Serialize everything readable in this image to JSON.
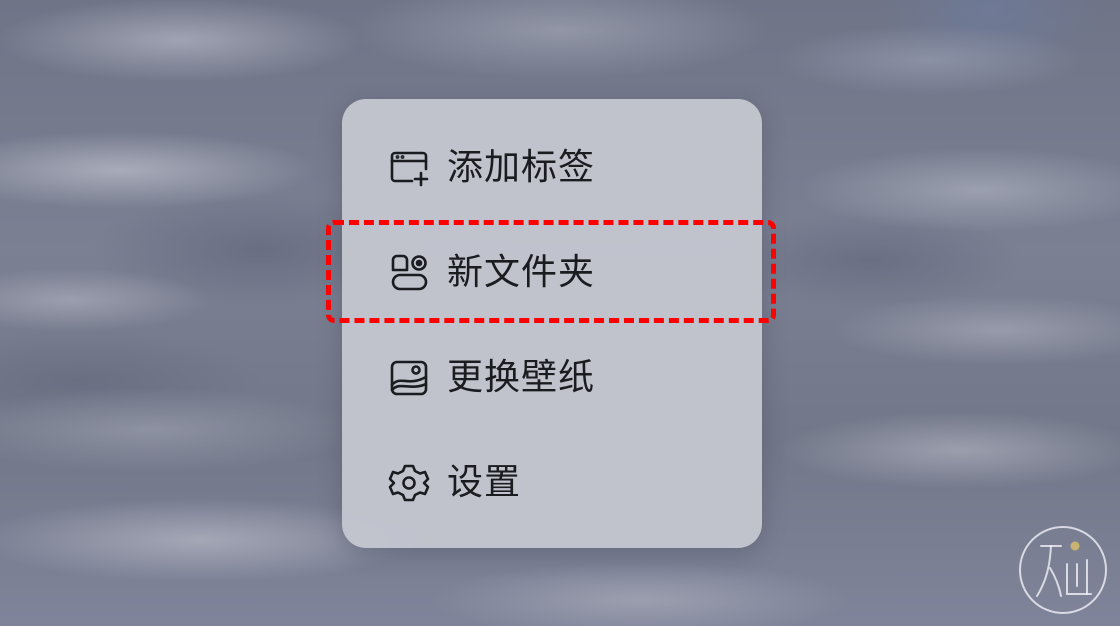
{
  "menu": {
    "items": [
      {
        "label": "添加标签",
        "icon": "tab-add-icon"
      },
      {
        "label": "新文件夹",
        "icon": "folder-icon"
      },
      {
        "label": "更换壁纸",
        "icon": "wallpaper-icon"
      },
      {
        "label": "设置",
        "icon": "gear-icon"
      }
    ]
  },
  "highlight": {
    "target": "新文件夹",
    "color": "#ff0000",
    "style": "dashed"
  },
  "colors": {
    "menu_background": "#c4c6d0",
    "menu_text": "#1b1c20",
    "wallpaper": "#777c8e"
  },
  "watermark": {
    "icon": "logo-watermark-icon"
  }
}
